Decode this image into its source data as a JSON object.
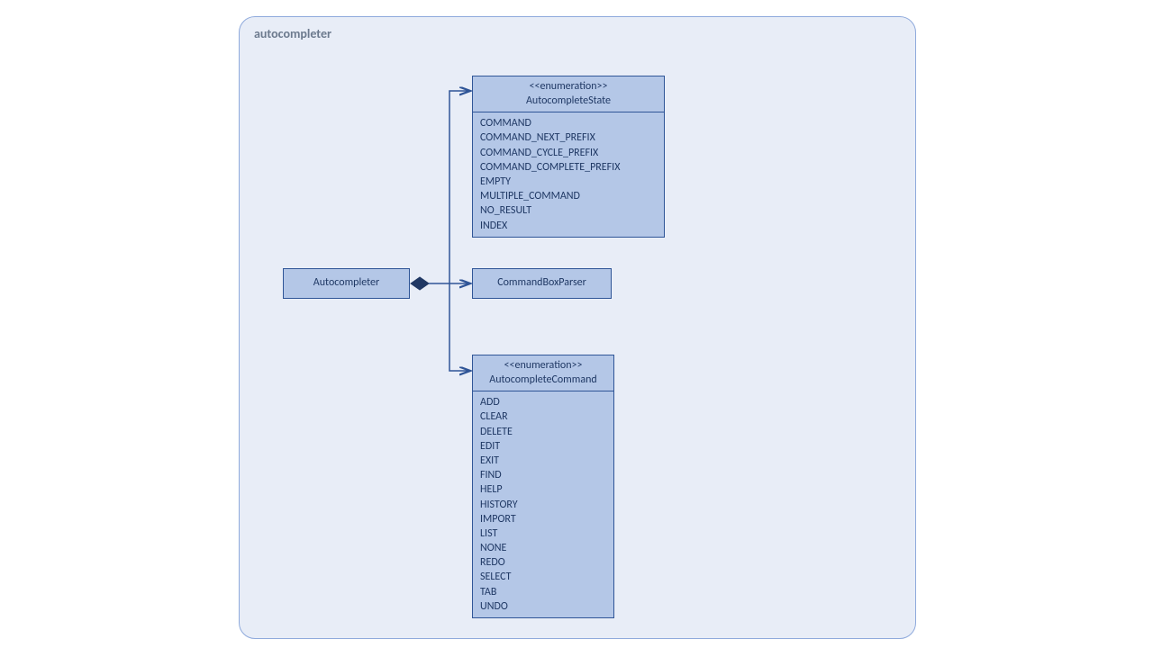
{
  "package": {
    "name": "autocompleter"
  },
  "classes": {
    "autocompleter": {
      "name": "Autocompleter"
    },
    "commandBoxParser": {
      "name": "CommandBoxParser"
    },
    "autocompleteState": {
      "stereotype": "<<enumeration>>",
      "name": "AutocompleteState",
      "values": [
        "COMMAND",
        "COMMAND_NEXT_PREFIX",
        "COMMAND_CYCLE_PREFIX",
        "COMMAND_COMPLETE_PREFIX",
        "EMPTY",
        "MULTIPLE_COMMAND",
        "NO_RESULT",
        "INDEX"
      ]
    },
    "autocompleteCommand": {
      "stereotype": "<<enumeration>>",
      "name": "AutocompleteCommand",
      "values": [
        "ADD",
        "CLEAR",
        "DELETE",
        "EDIT",
        "EXIT",
        "FIND",
        "HELP",
        "HISTORY",
        "IMPORT",
        "LIST",
        "NONE",
        "REDO",
        "SELECT",
        "TAB",
        "UNDO"
      ]
    }
  }
}
